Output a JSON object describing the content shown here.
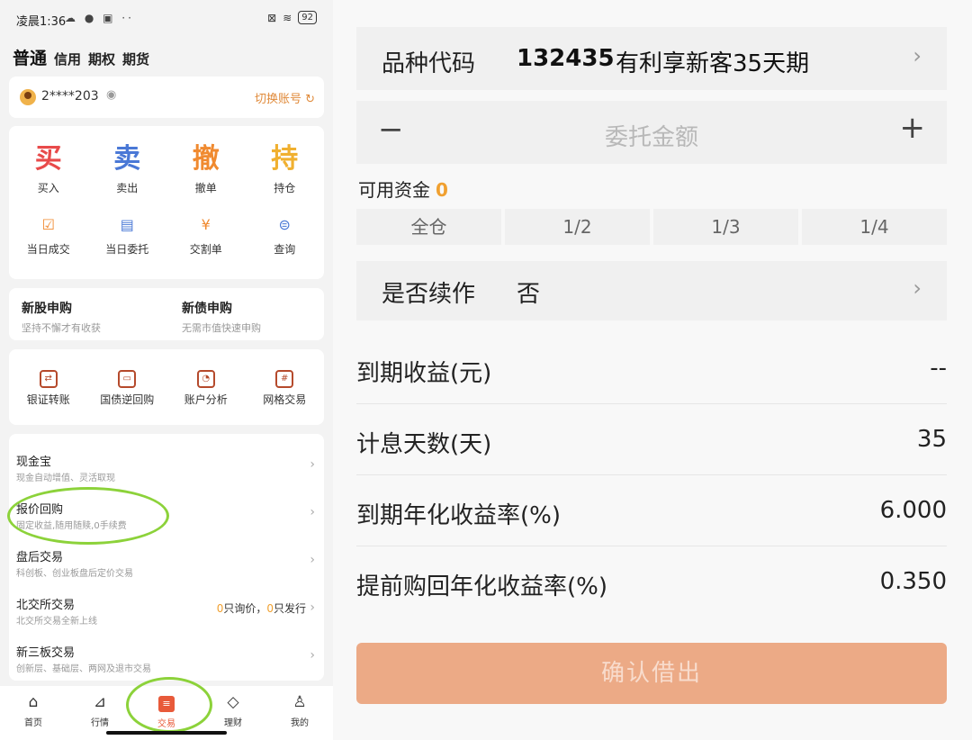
{
  "status_bar": {
    "time": "凌晨1:36",
    "battery": "92"
  },
  "account_tabs": [
    "普通",
    "信用",
    "期权",
    "期货"
  ],
  "account": {
    "number": "2****203",
    "switch_label": "切换账号"
  },
  "trade_primary": [
    {
      "char": "买",
      "label": "买入",
      "color": "#e84a4a"
    },
    {
      "char": "卖",
      "label": "卖出",
      "color": "#4a78d6"
    },
    {
      "char": "撤",
      "label": "撤单",
      "color": "#f08a30"
    },
    {
      "char": "持",
      "label": "持仓",
      "color": "#f0b030"
    }
  ],
  "trade_secondary": [
    {
      "icon": "calendar-check-icon",
      "label": "当日成交"
    },
    {
      "icon": "document-icon",
      "label": "当日委托"
    },
    {
      "icon": "receipt-icon",
      "label": "交割单"
    },
    {
      "icon": "search-icon",
      "label": "查询"
    }
  ],
  "ipo": [
    {
      "title": "新股申购",
      "subtitle": "坚持不懈才有收获"
    },
    {
      "title": "新债申购",
      "subtitle": "无需市值快速申购"
    }
  ],
  "tools": [
    {
      "icon": "transfer-icon",
      "label": "银证转账"
    },
    {
      "icon": "ticket-icon",
      "label": "国债逆回购"
    },
    {
      "icon": "analysis-icon",
      "label": "账户分析"
    },
    {
      "icon": "grid-icon",
      "label": "网格交易"
    }
  ],
  "services": [
    {
      "title": "现金宝",
      "subtitle": "现金自动增值、灵活取现"
    },
    {
      "title": "报价回购",
      "subtitle": "固定收益,随用随赎,0手续费"
    },
    {
      "title": "盘后交易",
      "subtitle": "科创板、创业板盘后定价交易"
    },
    {
      "title": "北交所交易",
      "subtitle": "北交所交易全新上线",
      "extra_count1": "0",
      "extra_text1": "只询价，",
      "extra_count2": "0",
      "extra_text2": "只发行"
    },
    {
      "title": "新三板交易",
      "subtitle": "创新层、基础层、两网及退市交易"
    }
  ],
  "bottom_nav": [
    {
      "icon": "home-icon",
      "label": "首页"
    },
    {
      "icon": "chart-icon",
      "label": "行情"
    },
    {
      "icon": "trade-icon",
      "label": "交易"
    },
    {
      "icon": "finance-icon",
      "label": "理财"
    },
    {
      "icon": "user-icon",
      "label": "我的"
    }
  ],
  "form": {
    "product_label": "品种代码",
    "product_code": "132435",
    "product_name": "有利享新客35天期",
    "amount_placeholder": "委托金额",
    "available_label": "可用资金",
    "available_value": "0",
    "ratios": [
      "全仓",
      "1/2",
      "1/3",
      "1/4"
    ],
    "renew_label": "是否续作",
    "renew_value": "否",
    "info": [
      {
        "label": "到期收益(元)",
        "value": "--"
      },
      {
        "label": "计息天数(天)",
        "value": "35"
      },
      {
        "label": "到期年化收益率(%)",
        "value": "6.000"
      },
      {
        "label": "提前购回年化收益率(%)",
        "value": "0.350"
      }
    ],
    "confirm_label": "确认借出"
  },
  "colors": {
    "accent": "#e85a3a",
    "highlight_ring": "#8cd23a",
    "button": "#ecaa86",
    "available": "#f0a030"
  }
}
